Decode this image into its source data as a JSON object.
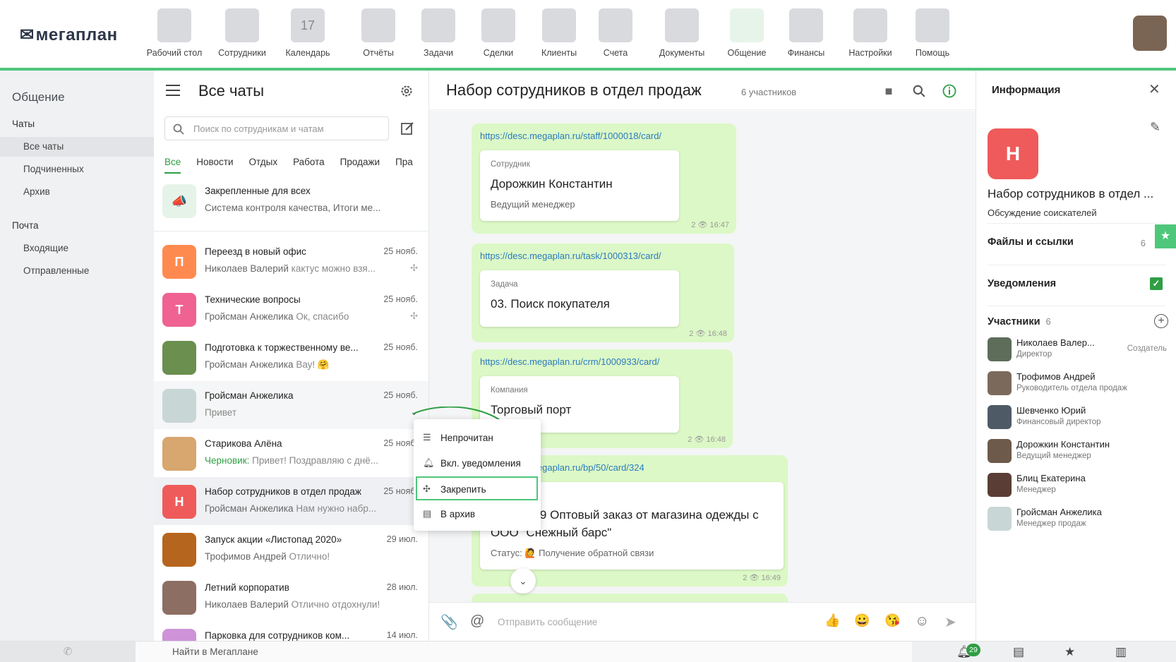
{
  "app": {
    "logo": "мегаплан"
  },
  "nav": [
    {
      "label": "Рабочий стол",
      "icon": "desktop-icon"
    },
    {
      "label": "Сотрудники",
      "icon": "employees-icon"
    },
    {
      "label": "Календарь",
      "icon": "calendar-icon",
      "icon_text": "17"
    },
    {
      "label": "Отчёты",
      "icon": "reports-icon"
    },
    {
      "label": "Задачи",
      "icon": "tasks-icon"
    },
    {
      "label": "Сделки",
      "icon": "deals-icon"
    },
    {
      "label": "Клиенты",
      "icon": "clients-icon"
    },
    {
      "label": "Счета",
      "icon": "invoices-icon"
    },
    {
      "label": "Документы",
      "icon": "documents-icon"
    },
    {
      "label": "Общение",
      "icon": "chat-icon",
      "active": true
    },
    {
      "label": "Финансы",
      "icon": "finance-icon"
    },
    {
      "label": "Настройки",
      "icon": "settings-icon"
    },
    {
      "label": "Помощь",
      "icon": "help-icon"
    }
  ],
  "leftnav": {
    "title": "Общение",
    "section_chats": "Чаты",
    "chats_items": [
      "Все чаты",
      "Подчиненных",
      "Архив"
    ],
    "section_mail": "Почта",
    "mail_items": [
      "Входящие",
      "Отправленные"
    ]
  },
  "chatlist": {
    "title": "Все чаты",
    "search_placeholder": "Поиск по сотрудникам и чатам",
    "tabs": [
      "Все",
      "Новости",
      "Отдых",
      "Работа",
      "Продажи",
      "Пра"
    ],
    "pinned": {
      "name": "Закрепленные для всех",
      "last": "Система контроля качества, Итоги ме..."
    },
    "rows": [
      {
        "initial": "П",
        "color": "#ff8a50",
        "name": "Переезд в новый офис",
        "date": "25 нояб.",
        "author": "Николаев Валерий",
        "text": "кактус можно взя..."
      },
      {
        "initial": "Т",
        "color": "#f06292",
        "name": "Технические вопросы",
        "date": "25 нояб.",
        "author": "Гройсман Анжелика",
        "text": "Ок, спасибо"
      },
      {
        "initial": "",
        "color": "#6a8f4e",
        "name": "Подготовка к торжественному ве...",
        "date": "25 нояб.",
        "author": "Гройсман Анжелика",
        "text": "Вау! 🤗"
      },
      {
        "initial": "",
        "color": "#c9d6d6",
        "name": "Гройсман Анжелика",
        "date": "25 нояб.",
        "author": "",
        "text": "Привет"
      },
      {
        "initial": "",
        "color": "#d8a66f",
        "name": "Старикова Алёна",
        "date": "25 нояб.",
        "author": "Черновик:",
        "text": "Привет! Поздравляю с днё..."
      },
      {
        "initial": "Н",
        "color": "#ef5b5b",
        "name": "Набор сотрудников в отдел продаж",
        "date": "25 нояб.",
        "author": "Гройсман Анжелика",
        "text": "Нам нужно набр..."
      },
      {
        "initial": "",
        "color": "#b5651d",
        "name": "Запуск акции «Листопад 2020»",
        "date": "29 июл.",
        "author": "Трофимов Андрей",
        "text": "Отлично!"
      },
      {
        "initial": "",
        "color": "#8d6e63",
        "name": "Летний корпоратив",
        "date": "28 июл.",
        "author": "Николаев Валерий",
        "text": "Отлично отдохнули!"
      },
      {
        "initial": "",
        "color": "#ce93d8",
        "name": "Парковка для сотрудников ком...",
        "date": "14 июл.",
        "author": "",
        "text": ""
      }
    ]
  },
  "context_menu": [
    "Непрочитан",
    "Вкл. уведомления",
    "Закрепить",
    "В архив"
  ],
  "chat": {
    "title": "Набор сотрудников в отдел продаж",
    "members": "6 участников",
    "messages": [
      {
        "link": "https://desc.megaplan.ru/staff/1000018/card/",
        "kind": "Сотрудник",
        "title": "Дорожкин Константин",
        "sub": "Ведущий менеджер",
        "time": "2 👁 16:47"
      },
      {
        "link": "https://desc.megaplan.ru/task/1000313/card/",
        "kind": "Задача",
        "title": "03. Поиск покупателя",
        "sub": "",
        "time": "2 👁 16:48"
      },
      {
        "link": "https://desc.megaplan.ru/crm/1000933/card/",
        "kind": "Компания",
        "title": "Торговый порт",
        "sub": "",
        "time": "2 👁 16:48"
      },
      {
        "link": "https://desc.megaplan.ru/bp/50/card/324",
        "kind": "",
        "title": "K-3241-19 Оптовый заказ от магазина одежды с ООО \"Снежный барс\"",
        "sub": "Статус: 🙋 Получение обратной связи",
        "time": "2 👁 16:49"
      }
    ],
    "input_placeholder": "Отправить сообщение"
  },
  "info": {
    "title": "Информация",
    "initial": "Н",
    "name": "Набор сотрудников в отдел ...",
    "desc": "Обсуждение соискателей",
    "files_label": "Файлы и ссылки",
    "files_count": "6",
    "notif_label": "Уведомления",
    "participants_label": "Участники",
    "participants_count": "6",
    "creator_label": "Создатель",
    "participants": [
      {
        "name": "Николаев Валер...",
        "role": "Директор",
        "color": "#5d6d5a"
      },
      {
        "name": "Трофимов Андрей",
        "role": "Руководитель отдела продаж",
        "color": "#7b6a5c"
      },
      {
        "name": "Шевченко Юрий",
        "role": "Финансовый директор",
        "color": "#4e5a66"
      },
      {
        "name": "Дорожкин Константин",
        "role": "Ведущий менеджер",
        "color": "#6d5a4a"
      },
      {
        "name": "Блиц Екатерина",
        "role": "Менеджер",
        "color": "#5a3e36"
      },
      {
        "name": "Гройсман Анжелика",
        "role": "Менеджер продаж",
        "color": "#c9d6d6"
      }
    ]
  },
  "bottom": {
    "search": "Найти в Мегаплане",
    "notifications": "29"
  }
}
